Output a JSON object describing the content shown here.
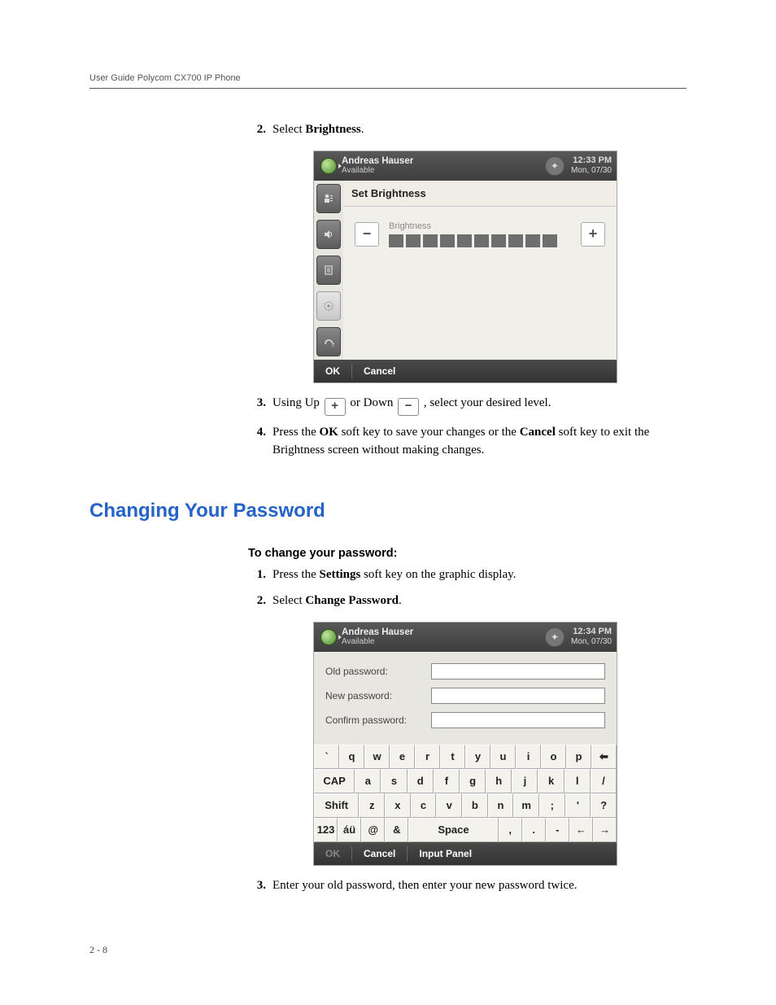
{
  "document": {
    "header": "User Guide Polycom CX700 IP Phone",
    "page_number": "2 - 8"
  },
  "steps_a": {
    "s2": {
      "num": "2.",
      "before": "Select ",
      "bold": "Brightness",
      "after": "."
    },
    "s3": {
      "num": "3.",
      "t1": "Using Up ",
      "plus": "+",
      "t2": " or Down ",
      "minus": "−",
      "t3": " , select your desired level."
    },
    "s4": {
      "num": "4.",
      "t1": "Press the ",
      "b1": "OK",
      "t2": " soft key to save your changes or the ",
      "b2": "Cancel",
      "t3": " soft key to exit the Brightness screen without making changes."
    }
  },
  "section_heading": "Changing Your Password",
  "sub_heading": "To change your password:",
  "steps_b": {
    "s1": {
      "num": "1.",
      "t1": "Press the ",
      "b1": "Settings",
      "t2": " soft key on the graphic display."
    },
    "s2": {
      "num": "2.",
      "t1": "Select ",
      "b1": "Change Password",
      "t2": "."
    },
    "s3": {
      "num": "3.",
      "text": "Enter your old password, then enter your new password twice."
    }
  },
  "phone1": {
    "user": "Andreas Hauser",
    "status": "Available",
    "time": "12:33 PM",
    "date": "Mon, 07/30",
    "screen_title": "Set Brightness",
    "brightness_label": "Brightness",
    "minus": "−",
    "plus": "+",
    "blocks_filled": 10,
    "soft_ok": "OK",
    "soft_cancel": "Cancel"
  },
  "phone2": {
    "user": "Andreas Hauser",
    "status": "Available",
    "time": "12:34 PM",
    "date": "Mon, 07/30",
    "labels": {
      "old": "Old password:",
      "new": "New password:",
      "confirm": "Confirm password:"
    },
    "values": {
      "old": "",
      "new": "",
      "confirm": ""
    },
    "soft_ok": "OK",
    "soft_cancel": "Cancel",
    "soft_input": "Input Panel",
    "keyboard": {
      "row1": [
        "`",
        "q",
        "w",
        "e",
        "r",
        "t",
        "y",
        "u",
        "i",
        "o",
        "p",
        "⬅"
      ],
      "row2": [
        "CAP",
        "a",
        "s",
        "d",
        "f",
        "g",
        "h",
        "j",
        "k",
        "l",
        "/"
      ],
      "row3": [
        "Shift",
        "z",
        "x",
        "c",
        "v",
        "b",
        "n",
        "m",
        ";",
        "'",
        "?"
      ],
      "row4": [
        "123",
        "áü",
        "@",
        "&",
        "Space",
        ",",
        ".",
        "-",
        "←",
        "→"
      ]
    }
  }
}
